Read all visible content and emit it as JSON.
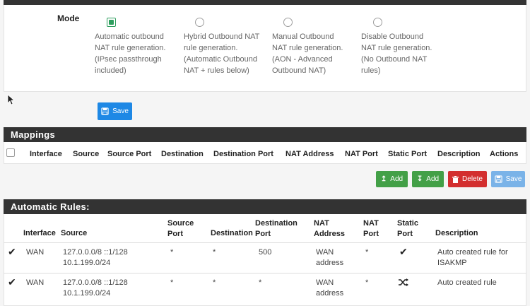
{
  "mode": {
    "label": "Mode",
    "options": [
      {
        "text": "Automatic outbound NAT rule generation. (IPsec passthrough included)",
        "checked": true
      },
      {
        "text": "Hybrid Outbound NAT rule generation. (Automatic Outbound NAT + rules below)",
        "checked": false
      },
      {
        "text": "Manual Outbound NAT rule generation. (AON - Advanced Outbound NAT)",
        "checked": false
      },
      {
        "text": "Disable Outbound NAT rule generation. (No Outbound NAT rules)",
        "checked": false
      }
    ],
    "save_label": "Save"
  },
  "mappings": {
    "title": "Mappings",
    "columns": [
      "Interface",
      "Source",
      "Source Port",
      "Destination",
      "Destination Port",
      "NAT Address",
      "NAT Port",
      "Static Port",
      "Description",
      "Actions"
    ],
    "buttons": {
      "add_top": "Add",
      "add_bottom": "Add",
      "delete": "Delete",
      "save": "Save"
    }
  },
  "auto_rules": {
    "title": "Automatic Rules:",
    "columns": {
      "interface": "Interface",
      "source": "Source",
      "source_port": "Source Port",
      "destination": "Destination",
      "destination_port": "Destination Port",
      "nat_address": "NAT Address",
      "nat_port": "NAT Port",
      "static_port": "Static Port",
      "description": "Description"
    },
    "rows": [
      {
        "interface": "WAN",
        "source": "127.0.0.0/8 ::1/128 10.1.199.0/24",
        "source_port": "*",
        "destination": "*",
        "destination_port": "500",
        "nat_address": "WAN address",
        "nat_port": "*",
        "static_port_icon": "check-icon",
        "description": "Auto created rule for ISAKMP"
      },
      {
        "interface": "WAN",
        "source": "127.0.0.0/8 ::1/128 10.1.199.0/24",
        "source_port": "*",
        "destination": "*",
        "destination_port": "*",
        "nat_address": "WAN address",
        "nat_port": "*",
        "static_port_icon": "shuffle-icon",
        "description": "Auto created rule"
      }
    ]
  },
  "colors": {
    "primary": "#1e88e5",
    "success": "#43a047",
    "danger": "#d32f2f",
    "header": "#333333"
  }
}
